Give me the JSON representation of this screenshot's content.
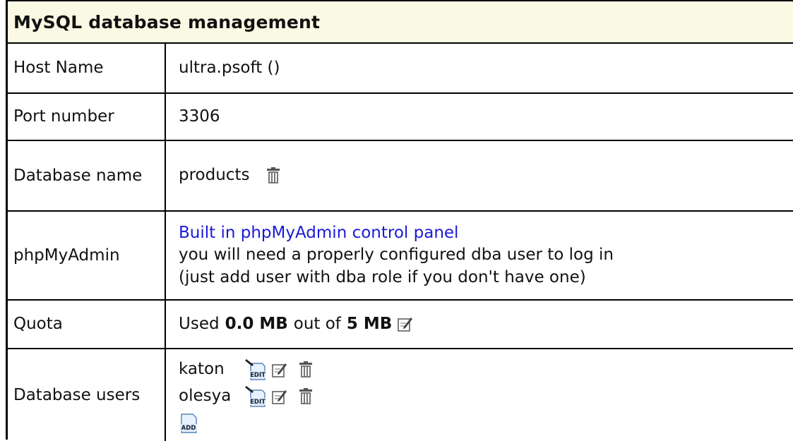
{
  "title": "MySQL database management",
  "rows": {
    "host": {
      "label": "Host Name",
      "value": "ultra.psoft ()"
    },
    "port": {
      "label": "Port number",
      "value": "3306"
    },
    "dbname": {
      "label": "Database name",
      "value": "products"
    },
    "phpmyadmin": {
      "label": "phpMyAdmin",
      "link_text": "Built in phpMyAdmin control panel",
      "note_line1": "you will need a properly configured dba user to log in",
      "note_line2": "(just add user with dba role if you don't have one)"
    },
    "quota": {
      "label": "Quota",
      "prefix": "Used",
      "used": "0.0 MB",
      "middle": "out of",
      "total": "5 MB"
    },
    "users": {
      "label": "Database users",
      "list": [
        "katon",
        "olesya"
      ]
    }
  },
  "icons": {
    "trash": "trash-icon",
    "edit_note": "edit-note-icon",
    "edit_doc": "edit-document-icon",
    "add_doc": "add-document-icon"
  },
  "icon_labels": {
    "edit": "EDIT",
    "add": "ADD"
  },
  "colors": {
    "title_bg": "#fafae4",
    "link": "#1a1ad8",
    "border": "#000000"
  }
}
